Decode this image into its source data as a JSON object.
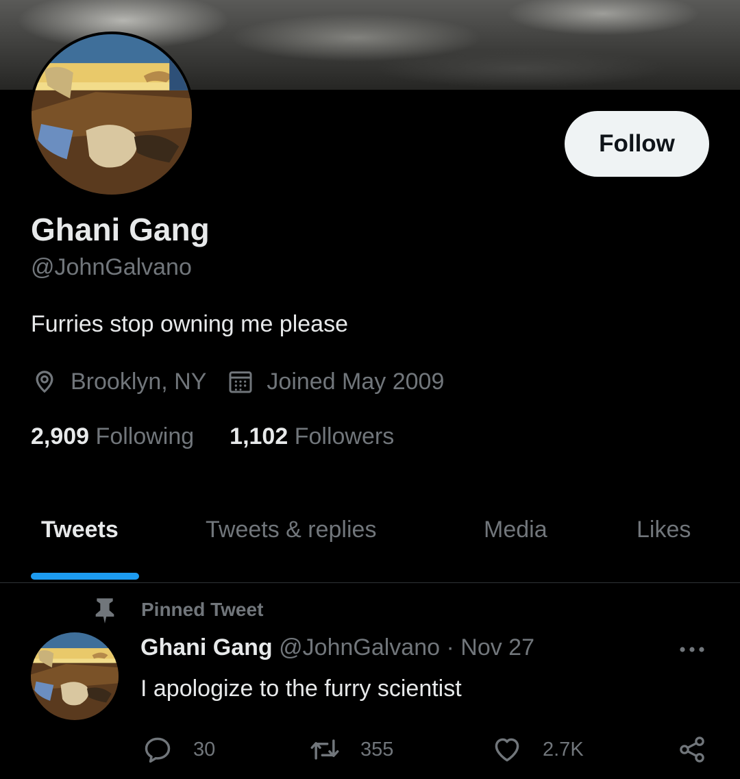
{
  "profile": {
    "display_name": "Ghani Gang",
    "handle": "@JohnGalvano",
    "bio": "Furries stop owning me please",
    "location": "Brooklyn, NY",
    "joined": "Joined May 2009",
    "follow_label": "Follow"
  },
  "stats": {
    "following_count": "2,909",
    "following_label": "Following",
    "followers_count": "1,102",
    "followers_label": "Followers"
  },
  "tabs": [
    {
      "label": "Tweets",
      "active": true
    },
    {
      "label": "Tweets & replies",
      "active": false
    },
    {
      "label": "Media",
      "active": false
    },
    {
      "label": "Likes",
      "active": false
    }
  ],
  "pinned_tweet": {
    "pinned_label": "Pinned Tweet",
    "author_name": "Ghani Gang",
    "author_handle": "@JohnGalvano",
    "separator": "·",
    "date": "Nov 27",
    "text": "I apologize to the furry scientist",
    "replies": "30",
    "retweets": "355",
    "likes": "2.7K"
  },
  "icons": {
    "location": "location-pin-icon",
    "calendar": "calendar-icon",
    "pin": "pushpin-icon",
    "reply": "reply-icon",
    "retweet": "retweet-icon",
    "like": "heart-icon",
    "share": "share-icon",
    "more": "more-icon"
  },
  "colors": {
    "background": "#000000",
    "accent": "#1d9bf0",
    "primary_text": "#e7e9ea",
    "secondary_text": "#71767b",
    "follow_button_bg": "#eff3f4"
  }
}
